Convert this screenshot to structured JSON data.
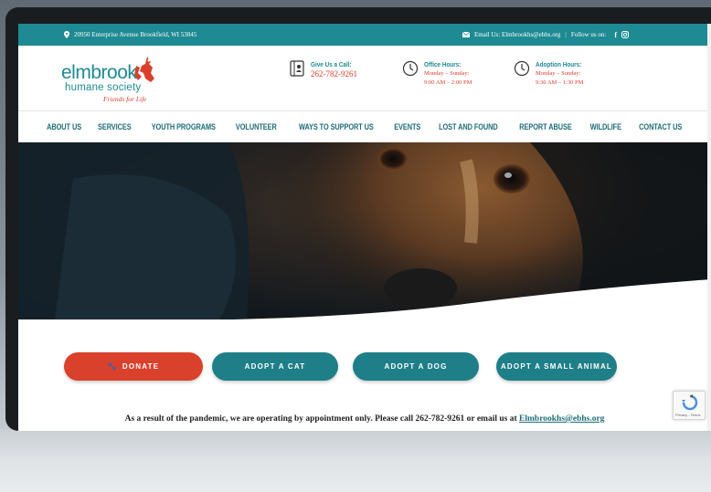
{
  "topbar": {
    "address": "20950 Enterprise Avenue Brookfield, WI 53045",
    "email_text": "Email Us: Elmbrookhs@ebhs.org",
    "separator": "|",
    "follow_text": "Follow us on:",
    "facebook_glyph": "f",
    "bg_color": "#1e8a93"
  },
  "logo": {
    "line1": "elmbrook",
    "line2": "humane society",
    "tagline": "Friends for Life"
  },
  "header": {
    "call": {
      "title": "Give Us a Call:",
      "phone": "262-782-9261"
    },
    "office": {
      "title": "Office Hours:",
      "days": "Monday – Sunday:",
      "time": "9:00 AM – 2:00 PM"
    },
    "adoption": {
      "title": "Adoption Hours:",
      "days": "Monday – Sunday:",
      "time": "9:30 AM – 1:30 PM"
    }
  },
  "nav": {
    "items": [
      "ABOUT US",
      "SERVICES",
      "YOUTH PROGRAMS",
      "VOLUNTEER",
      "WAYS TO SUPPORT US",
      "EVENTS",
      "LOST AND FOUND",
      "REPORT ABUSE",
      "WILDLIFE",
      "CONTACT US"
    ]
  },
  "buttons": {
    "donate": "DONATE",
    "cat": "ADOPT A CAT",
    "dog": "ADOPT A DOG",
    "small": "ADOPT A SMALL ANIMAL"
  },
  "notice": {
    "text": "As a result of the pandemic, we are operating by appointment only. Please call 262-782-9261 or email us at ",
    "link": "Elmbrookhs@ebhs.org"
  },
  "captcha": {
    "label": "Privacy - Terms"
  },
  "colors": {
    "accent_red": "#d9412c",
    "accent_teal": "#1e7f88",
    "nav_text": "#1e6d78"
  }
}
